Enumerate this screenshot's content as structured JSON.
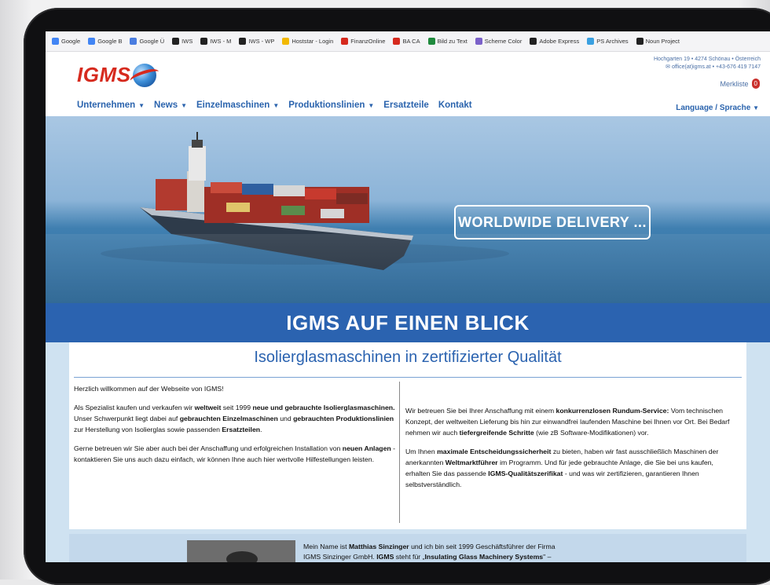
{
  "bookmarks": [
    {
      "label": "Google",
      "icon": "google-icon",
      "color": "#4285f4"
    },
    {
      "label": "Google B",
      "icon": "google-icon",
      "color": "#4285f4"
    },
    {
      "label": "Google Ü",
      "icon": "translate-icon",
      "color": "#4a7de0"
    },
    {
      "label": "IWS",
      "icon": "iws-icon",
      "color": "#222222"
    },
    {
      "label": "IWS - M",
      "icon": "iws-icon",
      "color": "#222222"
    },
    {
      "label": "IWS - WP",
      "icon": "iws-icon",
      "color": "#222222"
    },
    {
      "label": "Hoststar - Login",
      "icon": "hoststar-icon",
      "color": "#f2b800"
    },
    {
      "label": "FinanzOnline",
      "icon": "finanzonline-icon",
      "color": "#d62a1e"
    },
    {
      "label": "BA CA",
      "icon": "bank-icon",
      "color": "#d62a1e"
    },
    {
      "label": "Bild zu Text",
      "icon": "ocr-icon",
      "color": "#1f8a3d"
    },
    {
      "label": "Scheme Color",
      "icon": "palette-icon",
      "color": "#7b61c9"
    },
    {
      "label": "Adobe Express",
      "icon": "adobe-icon",
      "color": "#222222"
    },
    {
      "label": "PS Archives",
      "icon": "archive-icon",
      "color": "#3aa0e0"
    },
    {
      "label": "Noun Project",
      "icon": "noun-icon",
      "color": "#222222"
    }
  ],
  "header": {
    "logo_text": "IGMS",
    "address": "Hochgarten 19 • 4274 Schönau • Österreich",
    "contact": "office(at)igms.at • +43-676 419 7147",
    "merkliste_label": "Merkliste",
    "merkliste_count": "0"
  },
  "nav": {
    "items": [
      {
        "label": "Unternehmen",
        "dropdown": true
      },
      {
        "label": "News",
        "dropdown": true
      },
      {
        "label": "Einzelmaschinen",
        "dropdown": true
      },
      {
        "label": "Produktionslinien",
        "dropdown": true
      },
      {
        "label": "Ersatzteile",
        "dropdown": false
      },
      {
        "label": "Kontakt",
        "dropdown": false
      }
    ],
    "language_label": "Language / Sprache"
  },
  "hero": {
    "cta": "WORLDWIDE DELIVERY ..."
  },
  "band_title": "IGMS AUF EINEN BLICK",
  "main": {
    "heading": "Isolierglasmaschinen in zertifizierter Qualität",
    "left": {
      "p1": "Herzlich willkommen auf der Webseite von IGMS!",
      "p2_a": "Als Spezialist kaufen und verkaufen wir ",
      "p2_b": "weltweit",
      "p2_c": " seit 1999 ",
      "p2_d": "neue und gebrauchte Isolierglasmaschinen.",
      "p2_e": " Unser Schwerpunkt liegt dabei auf ",
      "p2_f": "gebrauchten Einzelmaschinen",
      "p2_g": " und ",
      "p2_h": "gebrauchten Produktionslinien",
      "p2_i": " zur Herstellung von Isolierglas sowie passenden ",
      "p2_j": "Ersatzteilen",
      "p2_k": ".",
      "p3_a": "Gerne betreuen wir Sie aber auch bei der Anschaffung und erfolgreichen Installation von ",
      "p3_b": "neuen Anlagen",
      "p3_c": " - kontaktieren Sie uns auch dazu einfach, wir können Ihne auch hier wertvolle Hilfestellungen leisten."
    },
    "right": {
      "p1_a": "Wir betreuen Sie bei Ihrer Anschaffung mit einem ",
      "p1_b": "konkurrenzlosen Rundum-Service:",
      "p1_c": " Vom technischen Konzept, der weltweiten Lieferung bis hin zur einwandfrei laufenden Maschine bei Ihnen vor Ort. Bei Bedarf nehmen wir auch ",
      "p1_d": "tiefergreifende Schritte",
      "p1_e": " (wie zB Software-Modifikationen) vor.",
      "p2_a": "Um Ihnen ",
      "p2_b": "maximale Entscheidungssicherheit",
      "p2_c": " zu bieten, haben wir fast ausschließlich Maschinen der anerkannten ",
      "p2_d": "Weltmarktführer",
      "p2_e": " im Programm. Und für jede gebrauchte Anlage, die Sie bei uns kaufen, erhalten Sie das passende ",
      "p2_f": "IGMS-Qualitätszerifikat",
      "p2_g": " - und was wir zertifizieren, garantieren Ihnen selbstverständlich."
    },
    "bottom_a": "Mein Name ist ",
    "bottom_b": "Matthias Sinzinger",
    "bottom_c": " und ich bin seit 1999 Geschäftsführer der Firma",
    "bottom_d": "IGMS Sinzinger GmbH. ",
    "bottom_e": "IGMS",
    "bottom_f": " steht für „",
    "bottom_g": "Insulating Glass Machinery Systems",
    "bottom_h": "\" –"
  }
}
